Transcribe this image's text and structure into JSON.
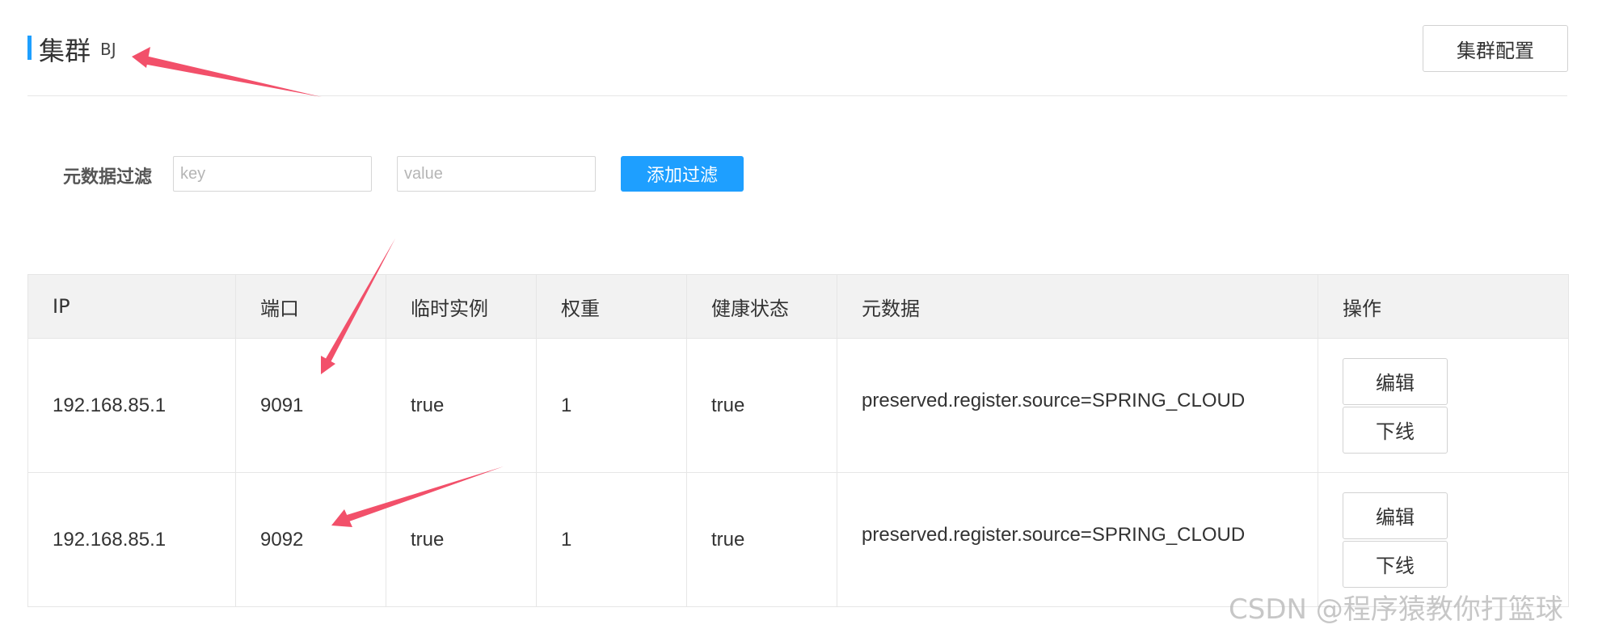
{
  "header": {
    "title": "集群",
    "cluster_name": "BJ",
    "config_button": "集群配置"
  },
  "filter": {
    "label": "元数据过滤",
    "key_placeholder": "key",
    "value_placeholder": "value",
    "add_button": "添加过滤"
  },
  "table": {
    "columns": [
      "IP",
      "端口",
      "临时实例",
      "权重",
      "健康状态",
      "元数据",
      "操作"
    ],
    "rows": [
      {
        "ip": "192.168.85.1",
        "port": "9091",
        "ephemeral": "true",
        "weight": "1",
        "healthy": "true",
        "metadata": "preserved.register.source=SPRING_CLOUD",
        "edit_label": "编辑",
        "offline_label": "下线"
      },
      {
        "ip": "192.168.85.1",
        "port": "9092",
        "ephemeral": "true",
        "weight": "1",
        "healthy": "true",
        "metadata": "preserved.register.source=SPRING_CLOUD",
        "edit_label": "编辑",
        "offline_label": "下线"
      }
    ]
  },
  "watermark": "CSDN @程序猿教你打篮球",
  "colors": {
    "accent": "#1e9fff",
    "annotation_arrow": "#f2506a",
    "header_bg": "#f2f2f2",
    "border": "#e6e6e6"
  }
}
